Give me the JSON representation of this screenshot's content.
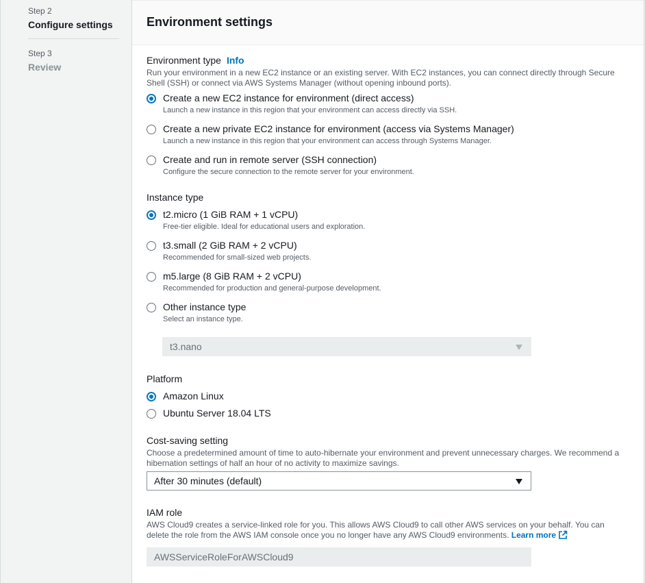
{
  "steps": [
    {
      "num": "Step 2",
      "title": "Configure settings"
    },
    {
      "num": "Step 3",
      "title": "Review"
    }
  ],
  "card": {
    "title": "Environment settings"
  },
  "environment_type": {
    "label": "Environment type",
    "info": "Info",
    "description": "Run your environment in a new EC2 instance or an existing server. With EC2 instances, you can connect directly through Secure Shell (SSH) or connect via AWS Systems Manager (without opening inbound ports).",
    "options": [
      {
        "label": "Create a new EC2 instance for environment (direct access)",
        "desc": "Launch a new instance in this region that your environment can access directly via SSH.",
        "checked": true
      },
      {
        "label": "Create a new private EC2 instance for environment (access via Systems Manager)",
        "desc": "Launch a new instance in this region that your environment can access through Systems Manager.",
        "checked": false
      },
      {
        "label": "Create and run in remote server (SSH connection)",
        "desc": "Configure the secure connection to the remote server for your environment.",
        "checked": false
      }
    ]
  },
  "instance_type": {
    "label": "Instance type",
    "options": [
      {
        "label": "t2.micro (1 GiB RAM + 1 vCPU)",
        "desc": "Free-tier eligible. Ideal for educational users and exploration.",
        "checked": true
      },
      {
        "label": "t3.small (2 GiB RAM + 2 vCPU)",
        "desc": "Recommended for small-sized web projects.",
        "checked": false
      },
      {
        "label": "m5.large (8 GiB RAM + 2 vCPU)",
        "desc": "Recommended for production and general-purpose development.",
        "checked": false
      },
      {
        "label": "Other instance type",
        "desc": "Select an instance type.",
        "checked": false
      }
    ],
    "other_select_value": "t3.nano"
  },
  "platform": {
    "label": "Platform",
    "options": [
      {
        "label": "Amazon Linux",
        "checked": true
      },
      {
        "label": "Ubuntu Server 18.04 LTS",
        "checked": false
      }
    ]
  },
  "cost_saving": {
    "label": "Cost-saving setting",
    "description": "Choose a predetermined amount of time to auto-hibernate your environment and prevent unnecessary charges. We recommend a hibernation settings of half an hour of no activity to maximize savings.",
    "value": "After 30 minutes (default)"
  },
  "iam_role": {
    "label": "IAM role",
    "description": "AWS Cloud9 creates a service-linked role for you. This allows AWS Cloud9 to call other AWS services on your behalf. You can delete the role from the AWS IAM console once you no longer have any AWS Cloud9 environments.",
    "learn_more": "Learn more",
    "value": "AWSServiceRoleForAWSCloud9"
  },
  "colors": {
    "accent": "#0073bb",
    "text": "#16191f",
    "muted": "#545b64"
  }
}
